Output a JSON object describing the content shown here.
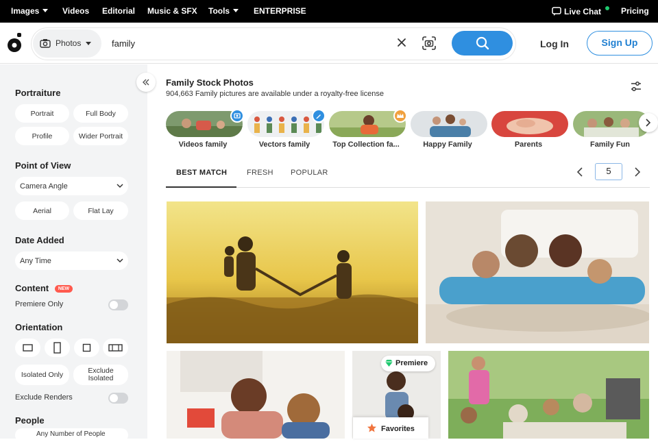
{
  "topnav": {
    "images": "Images",
    "videos": "Videos",
    "editorial": "Editorial",
    "music": "Music & SFX",
    "tools": "Tools",
    "enterprise": "ENTERPRISE",
    "live_chat": "Live Chat",
    "pricing": "Pricing"
  },
  "search": {
    "type": "Photos",
    "query": "family"
  },
  "auth": {
    "login": "Log In",
    "signup": "Sign Up"
  },
  "sidebar": {
    "portraiture": {
      "title": "Portraiture",
      "options": [
        "Portrait",
        "Full Body",
        "Profile",
        "Wider Portrait"
      ]
    },
    "point_of_view": {
      "title": "Point of View",
      "select": "Camera Angle",
      "options": [
        "Aerial",
        "Flat Lay"
      ]
    },
    "date_added": {
      "title": "Date Added",
      "select": "Any Time"
    },
    "content": {
      "title": "Content",
      "badge": "NEW",
      "premiere_only": "Premiere Only"
    },
    "orientation": {
      "title": "Orientation",
      "isolated_only": "Isolated Only",
      "exclude_isolated": "Exclude Isolated",
      "exclude_renders": "Exclude Renders"
    },
    "people": {
      "title": "People",
      "select": "Any Number of People"
    }
  },
  "results": {
    "title": "Family Stock Photos",
    "subtitle": "904,663 Family pictures are available under a royalty-free license"
  },
  "categories": [
    {
      "label": "Videos family"
    },
    {
      "label": "Vectors family"
    },
    {
      "label": "Top Collection fa..."
    },
    {
      "label": "Happy Family"
    },
    {
      "label": "Parents"
    },
    {
      "label": "Family Fun"
    }
  ],
  "tabs": [
    "BEST MATCH",
    "FRESH",
    "POPULAR"
  ],
  "pagination": {
    "page": "5"
  },
  "badges": {
    "premiere": "Premiere",
    "favorites": "Favorites"
  },
  "colors": {
    "accent": "#2f8fe0",
    "new_badge": "#ff5a4e",
    "premiere": "#1ec86e",
    "favorites_star": "#f0743e"
  }
}
